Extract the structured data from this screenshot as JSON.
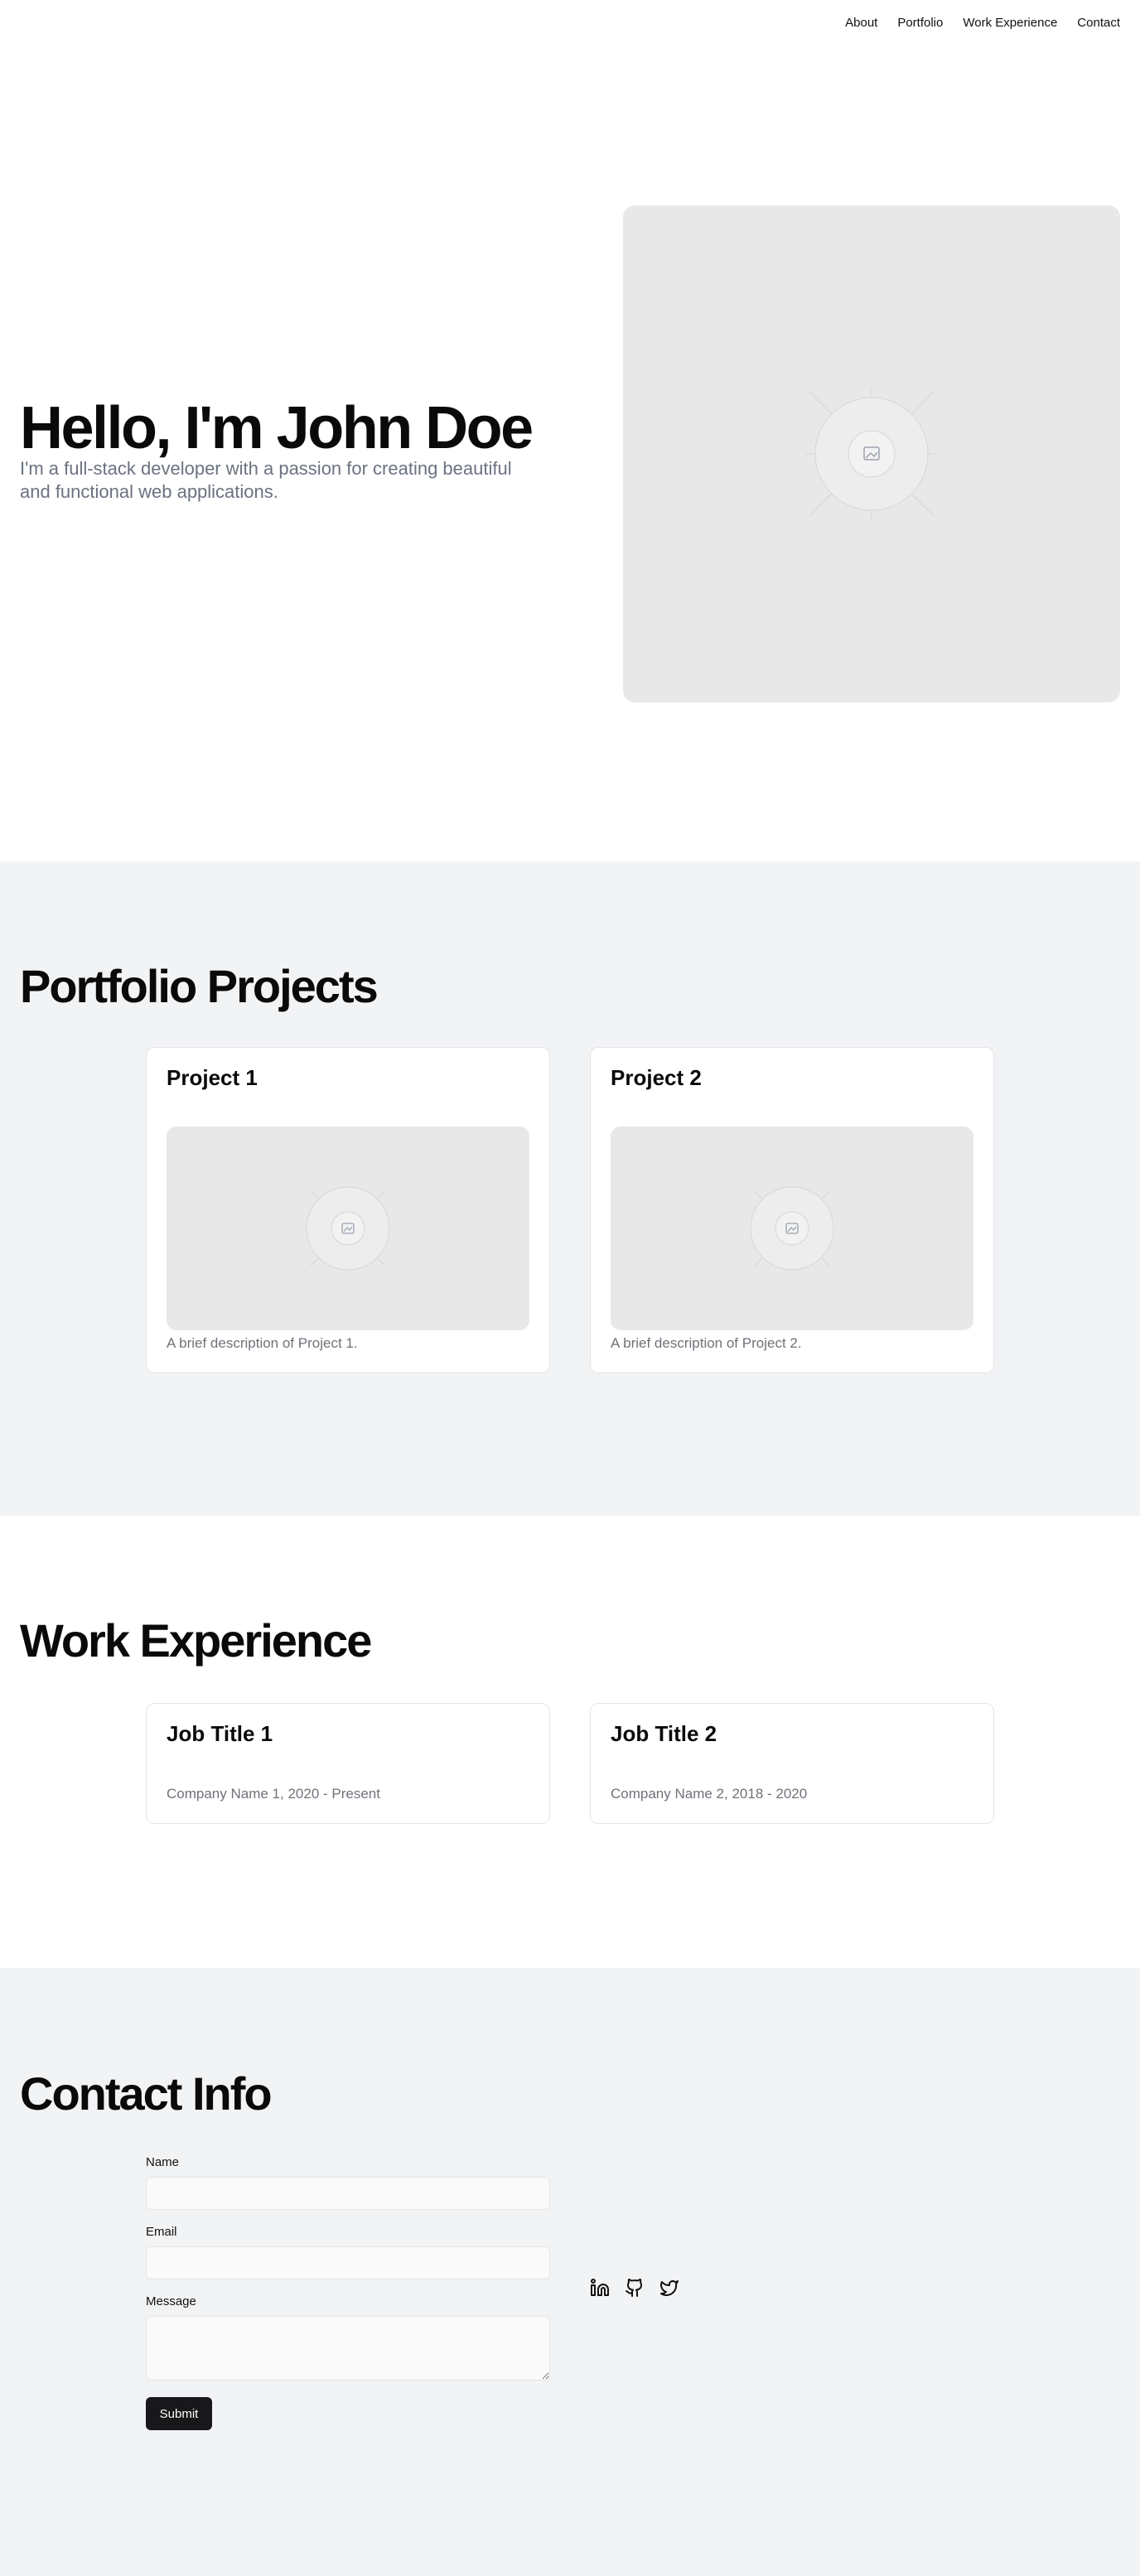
{
  "nav": {
    "links": [
      "About",
      "Portfolio",
      "Work Experience",
      "Contact"
    ]
  },
  "hero": {
    "title": "Hello, I'm John Doe",
    "subtitle": "I'm a full-stack developer with a passion for creating beautiful and functional web applications.",
    "image_icon": "image-placeholder-icon"
  },
  "portfolio": {
    "title": "Portfolio Projects",
    "projects": [
      {
        "title": "Project 1",
        "description": "A brief description of Project 1.",
        "image_icon": "image-placeholder-icon"
      },
      {
        "title": "Project 2",
        "description": "A brief description of Project 2.",
        "image_icon": "image-placeholder-icon"
      }
    ]
  },
  "work": {
    "title": "Work Experience",
    "jobs": [
      {
        "title": "Job Title 1",
        "company": "Company Name 1, 2020 - Present"
      },
      {
        "title": "Job Title 2",
        "company": "Company Name 2, 2018 - 2020"
      }
    ]
  },
  "contact": {
    "title": "Contact Info",
    "form": {
      "name_label": "Name",
      "name_value": "",
      "email_label": "Email",
      "email_value": "",
      "message_label": "Message",
      "message_value": "",
      "submit_label": "Submit"
    },
    "socials": [
      "linkedin-icon",
      "github-icon",
      "twitter-icon"
    ]
  },
  "colors": {
    "section_alt_bg": "#f2f3f5",
    "muted_text": "#6b7280",
    "button_bg": "#18181b",
    "placeholder_bg": "#e8e8e8"
  }
}
